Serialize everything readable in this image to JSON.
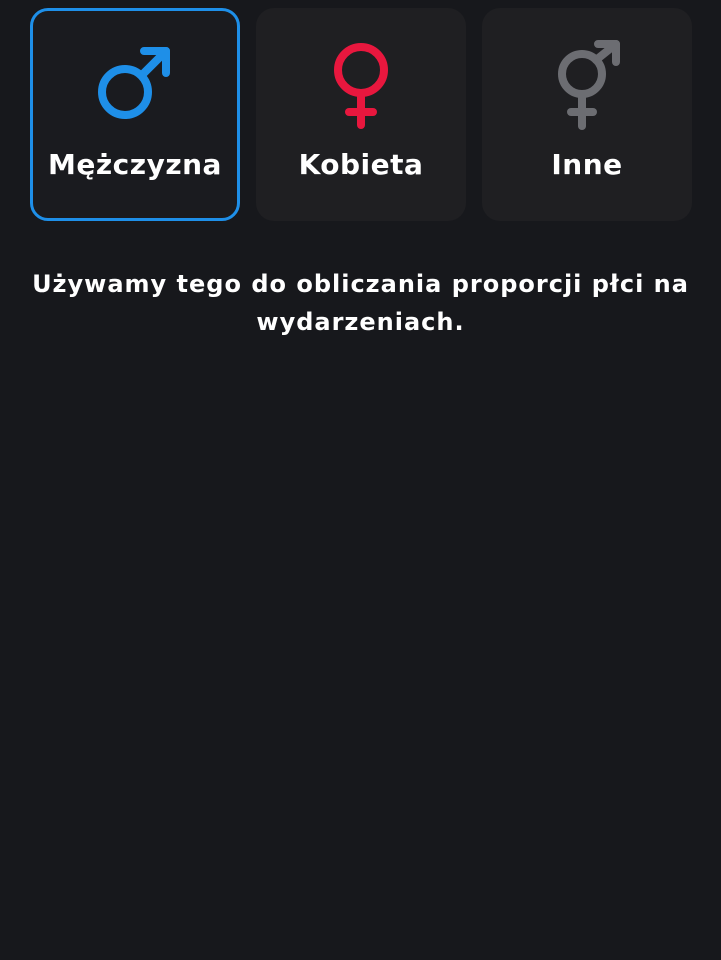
{
  "gender_options": [
    {
      "label": "Mężczyzna",
      "icon": "male-symbol-icon",
      "color": "#1e8fe8",
      "selected": true
    },
    {
      "label": "Kobieta",
      "icon": "female-symbol-icon",
      "color": "#e8173e",
      "selected": false
    },
    {
      "label": "Inne",
      "icon": "transgender-symbol-icon",
      "color": "#6c6d72",
      "selected": false
    }
  ],
  "hint": {
    "text": "Używamy tego do obliczania proporcji płci na wydarzeniach."
  },
  "colors": {
    "background": "#17181c",
    "card": "#1f1f22",
    "selected_border": "#1e8fe8"
  }
}
